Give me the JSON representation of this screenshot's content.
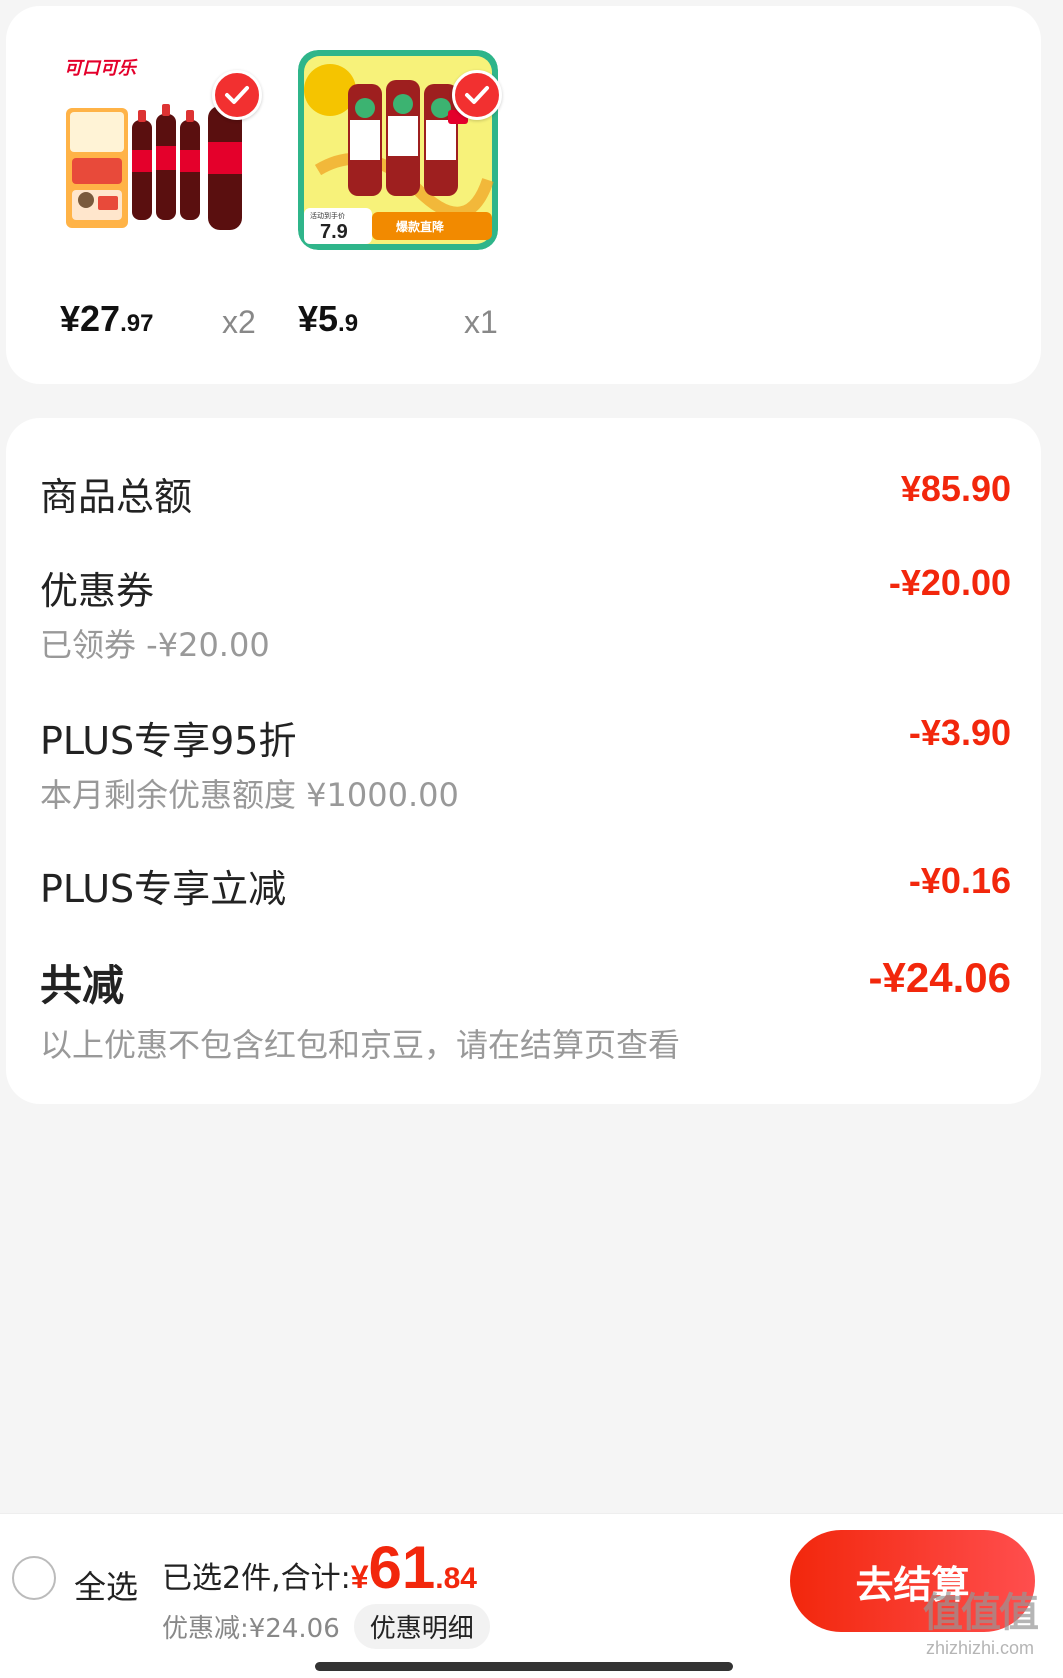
{
  "products": [
    {
      "brand_logo": "可口可乐",
      "price_int": "¥27",
      "price_dec": ".97",
      "qty": "x2",
      "checked": true
    },
    {
      "price_int": "¥5",
      "price_dec": ".9",
      "qty": "x1",
      "checked": true,
      "badge_price_label": "活动到手价",
      "badge_price": "7.9",
      "badge_tag": "爆款直降"
    }
  ],
  "summary": {
    "goods_total_label": "商品总额",
    "goods_total_value": "¥85.90",
    "coupon_label": "优惠券",
    "coupon_value": "-¥20.00",
    "coupon_sub": "已领券 -¥20.00",
    "plus_discount_label": "PLUS专享95折",
    "plus_discount_value": "-¥3.90",
    "plus_discount_sub": "本月剩余优惠额度 ¥1000.00",
    "plus_reduce_label": "PLUS专享立减",
    "plus_reduce_value": "-¥0.16",
    "total_reduce_label": "共减",
    "total_reduce_value": "-¥24.06",
    "note": "以上优惠不包含红包和京豆，请在结算页查看"
  },
  "bottom_bar": {
    "select_all_label": "全选",
    "selected_text": "已选2件,合计:",
    "total_yen": "¥",
    "total_int": "61",
    "total_dec": ".84",
    "discount_text": "优惠减:¥24.06",
    "detail_button": "优惠明细",
    "checkout_button": "去结算"
  },
  "watermark": {
    "logo": "值值值",
    "site": "zhizhizhi.com"
  },
  "colors": {
    "accent": "#f2270c",
    "check": "#f23030",
    "background": "#f5f5f5"
  }
}
